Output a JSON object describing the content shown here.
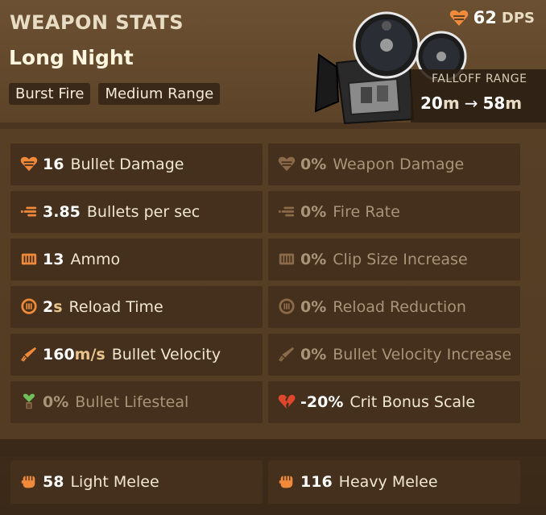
{
  "header": {
    "section_title": "WEAPON STATS",
    "weapon_name": "Long Night",
    "tags": [
      "Burst Fire",
      "Medium Range"
    ],
    "dps_value": "62",
    "dps_unit": "DPS",
    "falloff_title": "FALLOFF RANGE",
    "falloff_start": "20",
    "falloff_end": "58",
    "falloff_unit": "m",
    "weapon_icon": "film-camera-icon"
  },
  "stats": [
    {
      "icon": "heart-bullet-icon",
      "value": "16",
      "unit": "",
      "label": "Bullet Damage",
      "dim": false
    },
    {
      "icon": "heart-bullet-icon",
      "value": "0%",
      "unit": "",
      "label": "Weapon Damage",
      "dim": true
    },
    {
      "icon": "bullets-fire-rate-icon",
      "value": "3.85",
      "unit": "",
      "label": "Bullets per sec",
      "dim": false
    },
    {
      "icon": "bullets-fire-rate-icon",
      "value": "0%",
      "unit": "",
      "label": "Fire Rate",
      "dim": true
    },
    {
      "icon": "ammo-clip-icon",
      "value": "13",
      "unit": "",
      "label": "Ammo",
      "dim": false
    },
    {
      "icon": "ammo-clip-icon",
      "value": "0%",
      "unit": "",
      "label": "Clip Size Increase",
      "dim": true
    },
    {
      "icon": "reload-icon",
      "value": "2",
      "unit": "s",
      "label": "Reload Time",
      "dim": false
    },
    {
      "icon": "reload-icon",
      "value": "0%",
      "unit": "",
      "label": "Reload Reduction",
      "dim": true
    },
    {
      "icon": "bullet-velocity-icon",
      "value": "160",
      "unit": "m/s",
      "label": "Bullet Velocity",
      "dim": false
    },
    {
      "icon": "bullet-velocity-icon",
      "value": "0%",
      "unit": "",
      "label": "Bullet Velocity Increase",
      "dim": true
    },
    {
      "icon": "lifesteal-icon",
      "value": "0%",
      "unit": "",
      "label": "Bullet Lifesteal",
      "dim": true
    },
    {
      "icon": "broken-heart-icon",
      "value": "-20%",
      "unit": "",
      "label": "Crit Bonus Scale",
      "dim": false
    }
  ],
  "melee": [
    {
      "icon": "fist-icon",
      "value": "58",
      "label": "Light Melee"
    },
    {
      "icon": "fist-icon",
      "value": "116",
      "label": "Heavy Melee"
    }
  ],
  "colors": {
    "accent_orange": "#f08a3a",
    "dim_icon": "#8a6a48",
    "lifesteal_green": "#6fbf5a",
    "crit_red": "#e0462a"
  }
}
